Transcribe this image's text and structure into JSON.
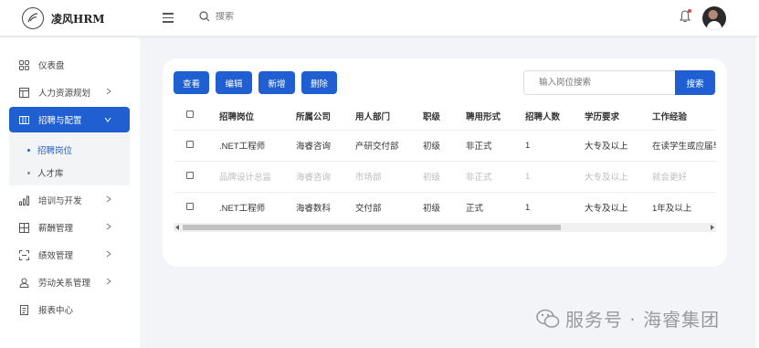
{
  "app": {
    "logo_text": "凌风HRM"
  },
  "header": {
    "search_placeholder": "搜索"
  },
  "sidebar": {
    "items": [
      {
        "label": "仪表盘"
      },
      {
        "label": "人力资源规划"
      },
      {
        "label": "招聘与配置"
      },
      {
        "label": "培训与开发"
      },
      {
        "label": "薪酬管理"
      },
      {
        "label": "绩效管理"
      },
      {
        "label": "劳动关系管理"
      },
      {
        "label": "报表中心"
      }
    ],
    "sub_items": [
      {
        "label": "招聘岗位"
      },
      {
        "label": "人才库"
      }
    ]
  },
  "toolbar": {
    "view_label": "查看",
    "edit_label": "编辑",
    "add_label": "新增",
    "delete_label": "删除",
    "position_search_placeholder": "输入岗位搜索",
    "search_label": "搜索"
  },
  "table": {
    "headers": [
      "招聘岗位",
      "所属公司",
      "用人部门",
      "职级",
      "聘用形式",
      "招聘人数",
      "学历要求",
      "工作经验"
    ],
    "rows": [
      {
        "cells": [
          ".NET工程师",
          "海睿咨询",
          "产研交付部",
          "初级",
          "非正式",
          "1",
          "大专及以上",
          "在读学生或应届毕业生"
        ],
        "dim": false
      },
      {
        "cells": [
          "品牌设计总监",
          "海睿咨询",
          "市场部",
          "初级",
          "非正式",
          "1",
          "大专及以上",
          "就会更好"
        ],
        "dim": true
      },
      {
        "cells": [
          ".NET工程师",
          "海睿数科",
          "交付部",
          "初级",
          "正式",
          "1",
          "大专及以上",
          "1年及以上"
        ],
        "dim": false
      }
    ]
  },
  "watermark": {
    "text": "服务号 · 海睿集团"
  },
  "colors": {
    "primary": "#1f5fd1",
    "background": "#f2f4f8"
  }
}
